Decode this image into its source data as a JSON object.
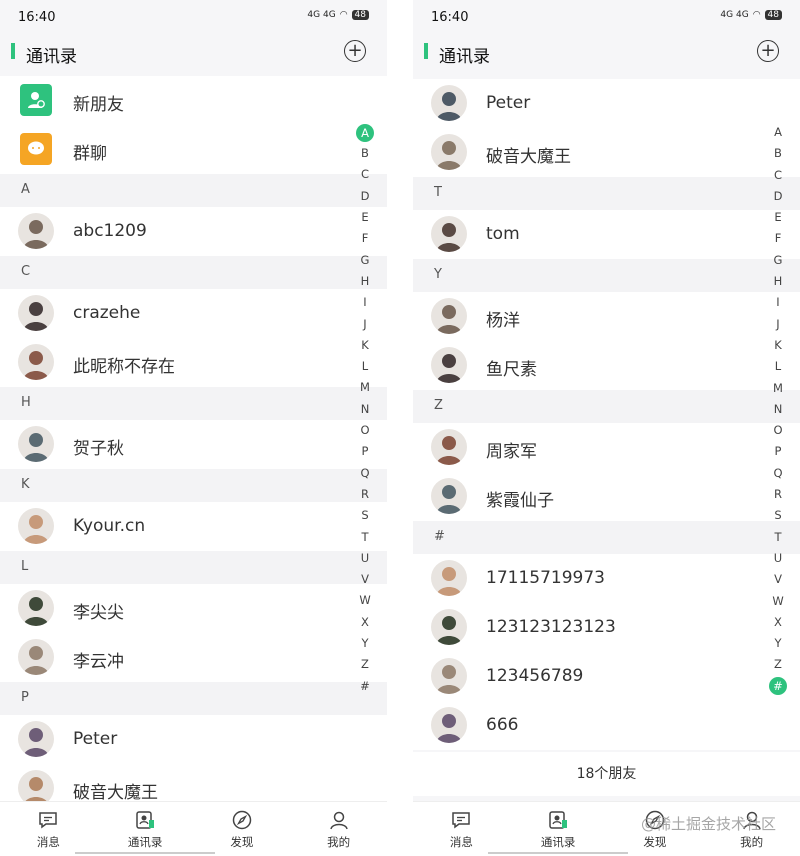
{
  "status": {
    "time": "16:40",
    "network": "4G 4G",
    "battery": "48"
  },
  "header": {
    "title": "通讯录",
    "add_icon": "plus-circle-icon"
  },
  "colors": {
    "accent": "#2ec27e",
    "new_friend": "#2ec27e",
    "group_chat": "#f5a524"
  },
  "left": {
    "special": [
      {
        "label": "新朋友",
        "icon": "add-person-icon"
      },
      {
        "label": "群聊",
        "icon": "chat-bubble-icon"
      }
    ],
    "sections": [
      {
        "letter": "A",
        "contacts": [
          "abc1209"
        ]
      },
      {
        "letter": "C",
        "contacts": [
          "crazehe",
          "此昵称不存在"
        ]
      },
      {
        "letter": "H",
        "contacts": [
          "贺子秋"
        ]
      },
      {
        "letter": "K",
        "contacts": [
          "Kyour.cn"
        ]
      },
      {
        "letter": "L",
        "contacts": [
          "李尖尖",
          "李云冲"
        ]
      },
      {
        "letter": "P",
        "contacts": [
          "Peter",
          "破音大魔王"
        ]
      }
    ]
  },
  "right": {
    "top_contacts": [
      "Peter",
      "破音大魔王"
    ],
    "sections": [
      {
        "letter": "T",
        "contacts": [
          "tom"
        ]
      },
      {
        "letter": "Y",
        "contacts": [
          "杨洋",
          "鱼尺素"
        ]
      },
      {
        "letter": "Z",
        "contacts": [
          "周家军",
          "紫霞仙子"
        ]
      },
      {
        "letter": "#",
        "contacts": [
          "17115719973",
          "123123123123",
          "123456789",
          "666"
        ]
      }
    ],
    "friend_count": "18个朋友"
  },
  "index_letters": [
    "A",
    "B",
    "C",
    "D",
    "E",
    "F",
    "G",
    "H",
    "I",
    "J",
    "K",
    "L",
    "M",
    "N",
    "O",
    "P",
    "Q",
    "R",
    "S",
    "T",
    "U",
    "V",
    "W",
    "X",
    "Y",
    "Z",
    "#"
  ],
  "tabs": [
    {
      "label": "消息",
      "icon": "message-icon"
    },
    {
      "label": "通讯录",
      "icon": "contacts-icon"
    },
    {
      "label": "发现",
      "icon": "compass-icon"
    },
    {
      "label": "我的",
      "icon": "person-icon"
    }
  ],
  "watermark": "@稀土掘金技术社区"
}
